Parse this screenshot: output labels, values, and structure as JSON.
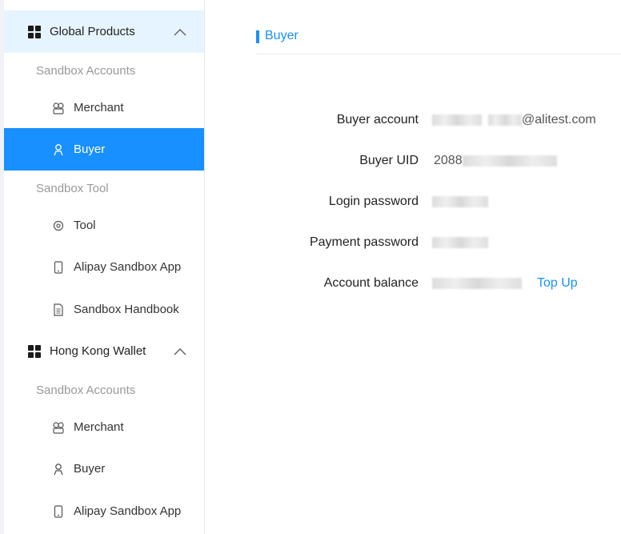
{
  "sidebar": {
    "groups": [
      {
        "label": "Global Products",
        "sections": [
          {
            "label": "Sandbox Accounts",
            "items": [
              {
                "label": "Merchant",
                "icon": "merchant-icon"
              },
              {
                "label": "Buyer",
                "icon": "buyer-icon",
                "active": true
              }
            ]
          },
          {
            "label": "Sandbox Tool",
            "items": [
              {
                "label": "Tool",
                "icon": "gear-icon"
              },
              {
                "label": "Alipay Sandbox App",
                "icon": "phone-icon"
              },
              {
                "label": "Sandbox Handbook",
                "icon": "document-icon"
              }
            ]
          }
        ]
      },
      {
        "label": "Hong Kong Wallet",
        "sections": [
          {
            "label": "Sandbox Accounts",
            "items": [
              {
                "label": "Merchant",
                "icon": "merchant-icon"
              },
              {
                "label": "Buyer",
                "icon": "buyer-icon"
              },
              {
                "label": "Alipay Sandbox App",
                "icon": "phone-icon"
              }
            ]
          }
        ]
      }
    ]
  },
  "main": {
    "title": "Buyer",
    "fields": {
      "account_label": "Buyer account",
      "account_suffix": "@alitest.com",
      "uid_label": "Buyer UID",
      "uid_prefix": "2088",
      "login_label": "Login password",
      "payment_label": "Payment password",
      "balance_label": "Account balance"
    },
    "top_up": "Top Up"
  },
  "colors": {
    "accent": "#1890ff",
    "header_highlight": "#e6f4ff"
  }
}
